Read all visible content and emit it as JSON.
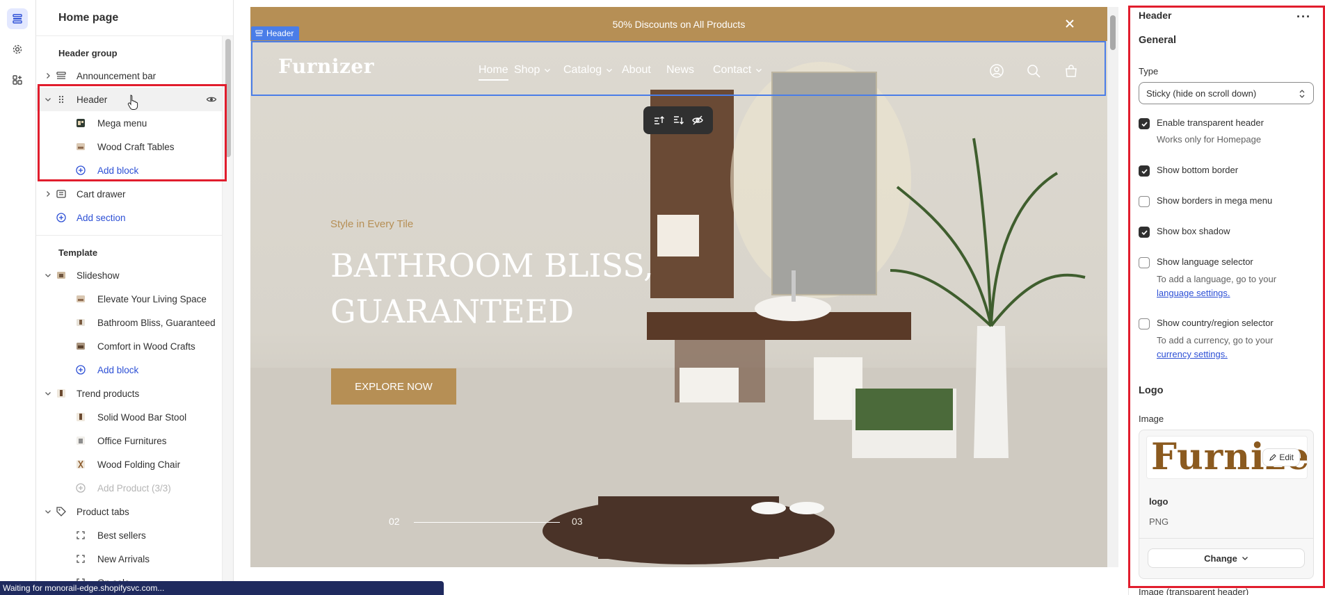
{
  "sidebar": {
    "title": "Home page",
    "header_group": "Header group",
    "header_items": [
      {
        "label": "Announcement bar"
      },
      {
        "label": "Header"
      },
      {
        "label": "Mega menu"
      },
      {
        "label": "Wood Craft Tables"
      },
      {
        "label": "Add block"
      },
      {
        "label": "Cart drawer"
      },
      {
        "label": "Add section"
      }
    ],
    "template": "Template",
    "template_items": [
      {
        "label": "Slideshow"
      },
      {
        "label": "Elevate Your Living Space"
      },
      {
        "label": "Bathroom Bliss, Guaranteed"
      },
      {
        "label": "Comfort in Wood Crafts"
      },
      {
        "label": "Add block"
      },
      {
        "label": "Trend products"
      },
      {
        "label": "Solid Wood Bar Stool"
      },
      {
        "label": "Office Furnitures"
      },
      {
        "label": "Wood Folding Chair"
      },
      {
        "label": "Add Product (3/3)"
      },
      {
        "label": "Product tabs"
      },
      {
        "label": "Best sellers"
      },
      {
        "label": "New Arrivals"
      },
      {
        "label": "On sale"
      }
    ]
  },
  "preview": {
    "announcement": "50% Discounts on All Products",
    "selection_tag": "Header",
    "logo": "Furnizer",
    "nav": [
      "Home",
      "Shop",
      "Catalog",
      "About",
      "News",
      "Contact"
    ],
    "slide_subtitle": "Style in Every Tile",
    "slide_title": "BATHROOM BLISS, GUARANTEED",
    "cta": "EXPLORE NOW",
    "page_current": "02",
    "page_next": "03"
  },
  "settings": {
    "title": "Header",
    "more": "···",
    "general": "General",
    "type_label": "Type",
    "type_value": "Sticky (hide on scroll down)",
    "enable_transparent": "Enable transparent header",
    "enable_transparent_help": "Works only for Homepage",
    "show_bottom_border": "Show bottom border",
    "show_borders_mega": "Show borders in mega menu",
    "show_box_shadow": "Show box shadow",
    "show_language": "Show language selector",
    "language_help": "To add a language, go to your",
    "language_link": "language settings.",
    "show_country": "Show country/region selector",
    "country_help": "To add a currency, go to your",
    "country_link": "currency settings.",
    "logo_heading": "Logo",
    "image_label": "Image",
    "logo_preview": "Furnizer",
    "edit": "Edit",
    "img_name": "logo",
    "img_type": "PNG",
    "change": "Change",
    "image_transparent": "Image (transparent header)"
  },
  "status_bar": "Waiting for monorail-edge.shopifysvc.com...",
  "colors": {
    "accent": "#b68f55",
    "selection": "#4a7de8",
    "highlight": "#e11d2d",
    "link": "#2c4fd5"
  }
}
